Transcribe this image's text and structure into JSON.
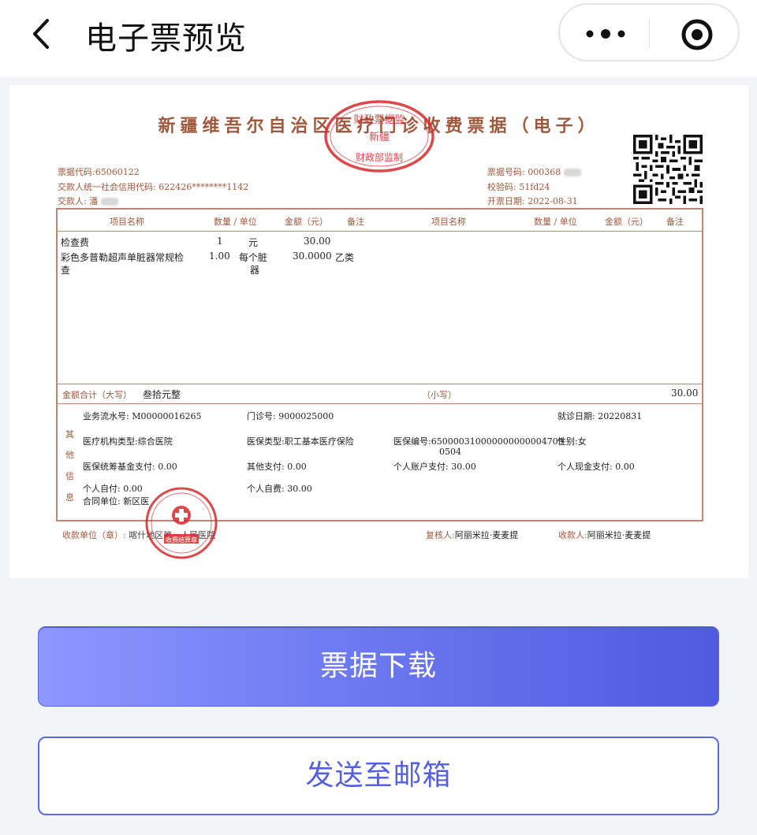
{
  "header": {
    "title": "电子票预览"
  },
  "invoice": {
    "title": "新疆维吾尔自治区医疗门诊收费票据（电子）",
    "stamp_top": {
      "line1": "财政票据监",
      "line2": "新疆",
      "line3": "财政部监制"
    },
    "meta_left": {
      "bill_code": "票据代码:65060122",
      "payer_credit_code": "交款人统一社会信用代码: 622426********1142",
      "payer": "交款人: 潘"
    },
    "meta_right": {
      "bill_number": "票据号码: 000368",
      "check_code_label": "校验码:",
      "check_code": "51fd24",
      "issue_date": "开票日期: 2022-08-31"
    },
    "columns": [
      "项目名称",
      "数量",
      "单位",
      "金额（元）",
      "备注",
      "项目名称",
      "数量",
      "单位",
      "金额（元）",
      "备注"
    ],
    "items": [
      {
        "name": "检查费",
        "qty": "1",
        "unit": "元",
        "amount": "30.00",
        "note": ""
      },
      {
        "name": "彩色多普勒超声单脏器常规检",
        "name2": "查",
        "qty": "1.00",
        "unit": "每个脏",
        "unit2": "器",
        "amount": "30.0000",
        "note": "乙类"
      }
    ],
    "total": {
      "label": "金额合计（大写）",
      "uppercase": "叁拾元整",
      "small_label": "（小写）",
      "value": "30.00"
    },
    "other_info_label": [
      "其",
      "他",
      "信",
      "息"
    ],
    "other": {
      "serial": "业务流水号: M00000016265",
      "clinic_no": "门诊号: 9000025000",
      "visit_date": "就诊日期: 20220831",
      "org_type_label": "医疗机构类型:",
      "org_type": "综合医院",
      "ins_type_label": "医保类型:",
      "ins_type": "职工基本医疗保险",
      "ins_no_label": "医保编号:",
      "ins_no_1": "650000310000000000004709",
      "ins_no_2": "0504",
      "gender_label": "性别:",
      "gender": "女",
      "pool_fund": "医保统筹基金支付: 0.00",
      "other_pay": "其他支付: 0.00",
      "personal_account": "个人账户支付: 30.00",
      "personal_cash": "个人现金支付: 0.00",
      "self_pay": "个人自付: 0.00",
      "self_expense": "个人自费: 30.00",
      "contract_unit": "合同单位: 新区医"
    },
    "footer": {
      "payee_unit_label": "收款单位（章）:",
      "payee_unit": "喀什地区第一人民医院",
      "reviewer_label": "复核人:",
      "reviewer": "阿丽米拉·麦麦提",
      "payee_label": "收款人:",
      "payee": "阿丽米拉·麦麦提"
    },
    "stamp_bottom": {
      "text": "收费结算章"
    }
  },
  "actions": {
    "download": "票据下载",
    "email": "发送至邮箱"
  },
  "colors": {
    "accent": "#5b66e6",
    "invoice_brown": "#a0583c",
    "stamp_red": "#d8282c"
  }
}
